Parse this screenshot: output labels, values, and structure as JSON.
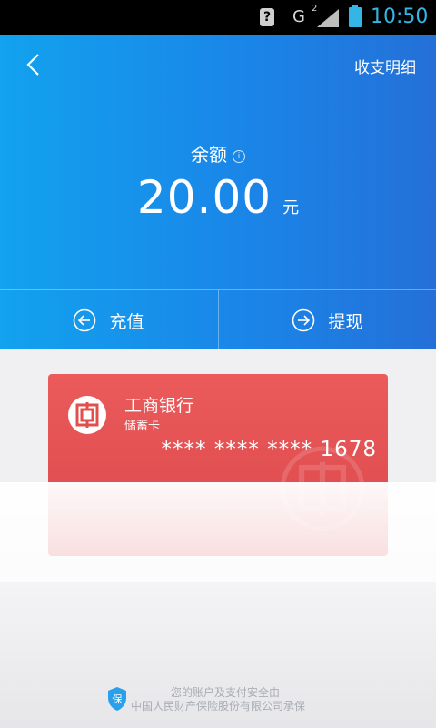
{
  "status_bar": {
    "network": "G",
    "network_sup": "2",
    "time": "10:50"
  },
  "header": {
    "back_icon": "chevron-left-icon",
    "details_link": "收支明细",
    "balance_label": "余额",
    "info_icon": "info-icon",
    "balance_value": "20.00",
    "balance_unit": "元"
  },
  "actions": [
    {
      "label": "充值",
      "icon": "arrow-left-circle-icon"
    },
    {
      "label": "提现",
      "icon": "arrow-right-circle-icon"
    }
  ],
  "card": {
    "bank_name": "工商银行",
    "card_type": "储蓄卡",
    "masked_number": "**** **** ****",
    "last_digits": "1678",
    "color": "#e0504f"
  },
  "footer": {
    "line1": "您的账户及支付安全由",
    "line2": "中国人民财产保险股份有限公司承保",
    "shield_char": "保"
  },
  "colors": {
    "header_blue": "#1a8ae9",
    "status_time": "#33b5e5"
  }
}
